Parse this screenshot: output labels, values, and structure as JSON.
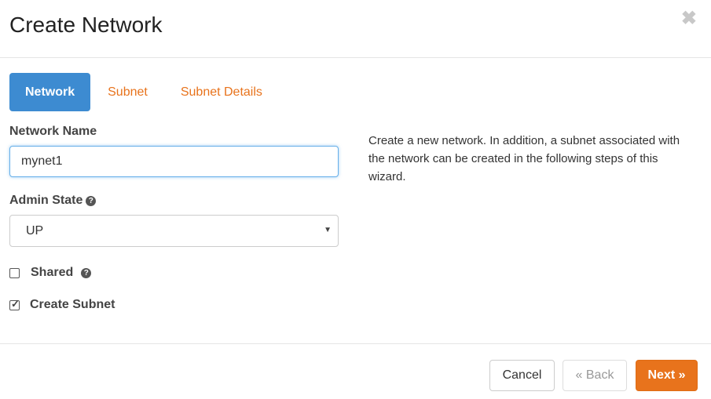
{
  "dialog": {
    "title": "Create Network",
    "close_label": "✖"
  },
  "tabs": [
    {
      "label": "Network",
      "active": true
    },
    {
      "label": "Subnet",
      "active": false
    },
    {
      "label": "Subnet Details",
      "active": false
    }
  ],
  "form": {
    "network_name_label": "Network Name",
    "network_name_value": "mynet1",
    "admin_state_label": "Admin State",
    "admin_state_value": "UP",
    "admin_state_options": [
      "UP"
    ],
    "shared_label": "Shared",
    "shared_checked": false,
    "create_subnet_label": "Create Subnet",
    "create_subnet_checked": true
  },
  "help_icon": "?",
  "description": "Create a new network. In addition, a subnet associated with the network can be created in the following steps of this wizard.",
  "footer": {
    "cancel_label": "Cancel",
    "back_label": "« Back",
    "next_label": "Next »"
  },
  "colors": {
    "accent": "#e8731c",
    "active_tab": "#3d8bd1"
  }
}
